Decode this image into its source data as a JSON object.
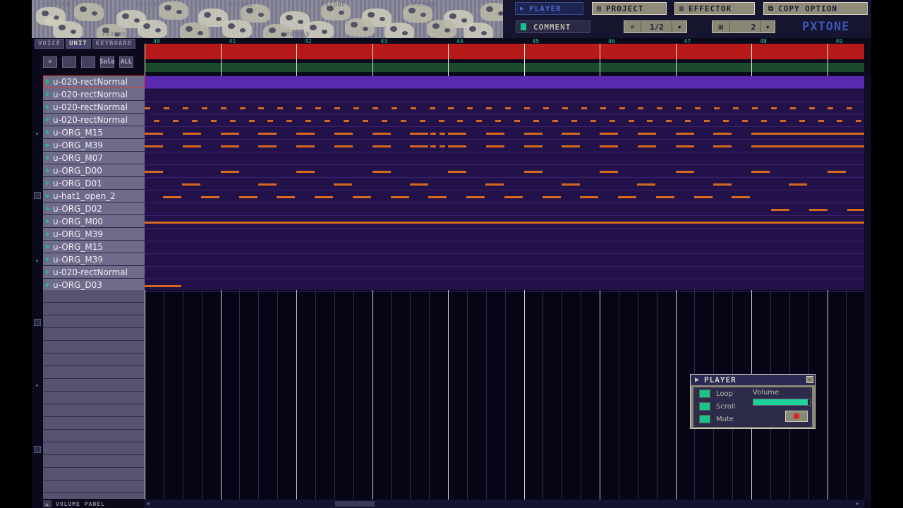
{
  "banner": {
    "pattern_text": "PXTONE"
  },
  "topbar": {
    "player_label": "PLAYER",
    "project_label": "PROJECT",
    "effector_label": "EFFECTOR",
    "copy_option_label": "COPY OPTION",
    "comment_label": "COMMENT",
    "zoom_value": "1/2",
    "division_value": "2",
    "logo_text": "PXTONE"
  },
  "left_tabs": [
    {
      "label": "VOICE"
    },
    {
      "label": "UNIT"
    },
    {
      "label": "KEYBOARD"
    }
  ],
  "left_tools": [
    {
      "label": "+"
    },
    {
      "label": ""
    },
    {
      "label": ""
    },
    {
      "label": "Solo"
    },
    {
      "label": "ALL"
    }
  ],
  "units": [
    {
      "name": "u-020-rectNormal"
    },
    {
      "name": "u-020-rectNormal"
    },
    {
      "name": "u-020-rectNormal"
    },
    {
      "name": "u-020-rectNormal"
    },
    {
      "name": "u-ORG_M15"
    },
    {
      "name": "u-ORG_M39"
    },
    {
      "name": "u-ORG_M07"
    },
    {
      "name": "u-ORG_D00"
    },
    {
      "name": "u-ORG_D01"
    },
    {
      "name": "u-hat1_open_2"
    },
    {
      "name": "u-ORG_D02"
    },
    {
      "name": "u-ORG_M00"
    },
    {
      "name": "u-ORG_M39"
    },
    {
      "name": "u-ORG_M15"
    },
    {
      "name": "u-ORG_M39"
    },
    {
      "name": "u-020-rectNormal"
    },
    {
      "name": "u-ORG_D03"
    }
  ],
  "selected_unit_index": 0,
  "measures": [
    "40",
    "41",
    "42",
    "43",
    "44",
    "45",
    "46",
    "47",
    "48",
    "49"
  ],
  "volume_panel_label": "VOLUME PANEL",
  "player_panel": {
    "title": "PLAYER",
    "loop_label": "Loop",
    "scroll_label": "Scroll",
    "mute_label": "Mute",
    "volume_label": "Volume",
    "volume_level": 0.96,
    "minimize_label": "−"
  },
  "colors": {
    "accent_green": "#19c28a",
    "ruler_red": "#b71818",
    "note_orange": "#d56a1f",
    "row_purple": "#23124a"
  }
}
